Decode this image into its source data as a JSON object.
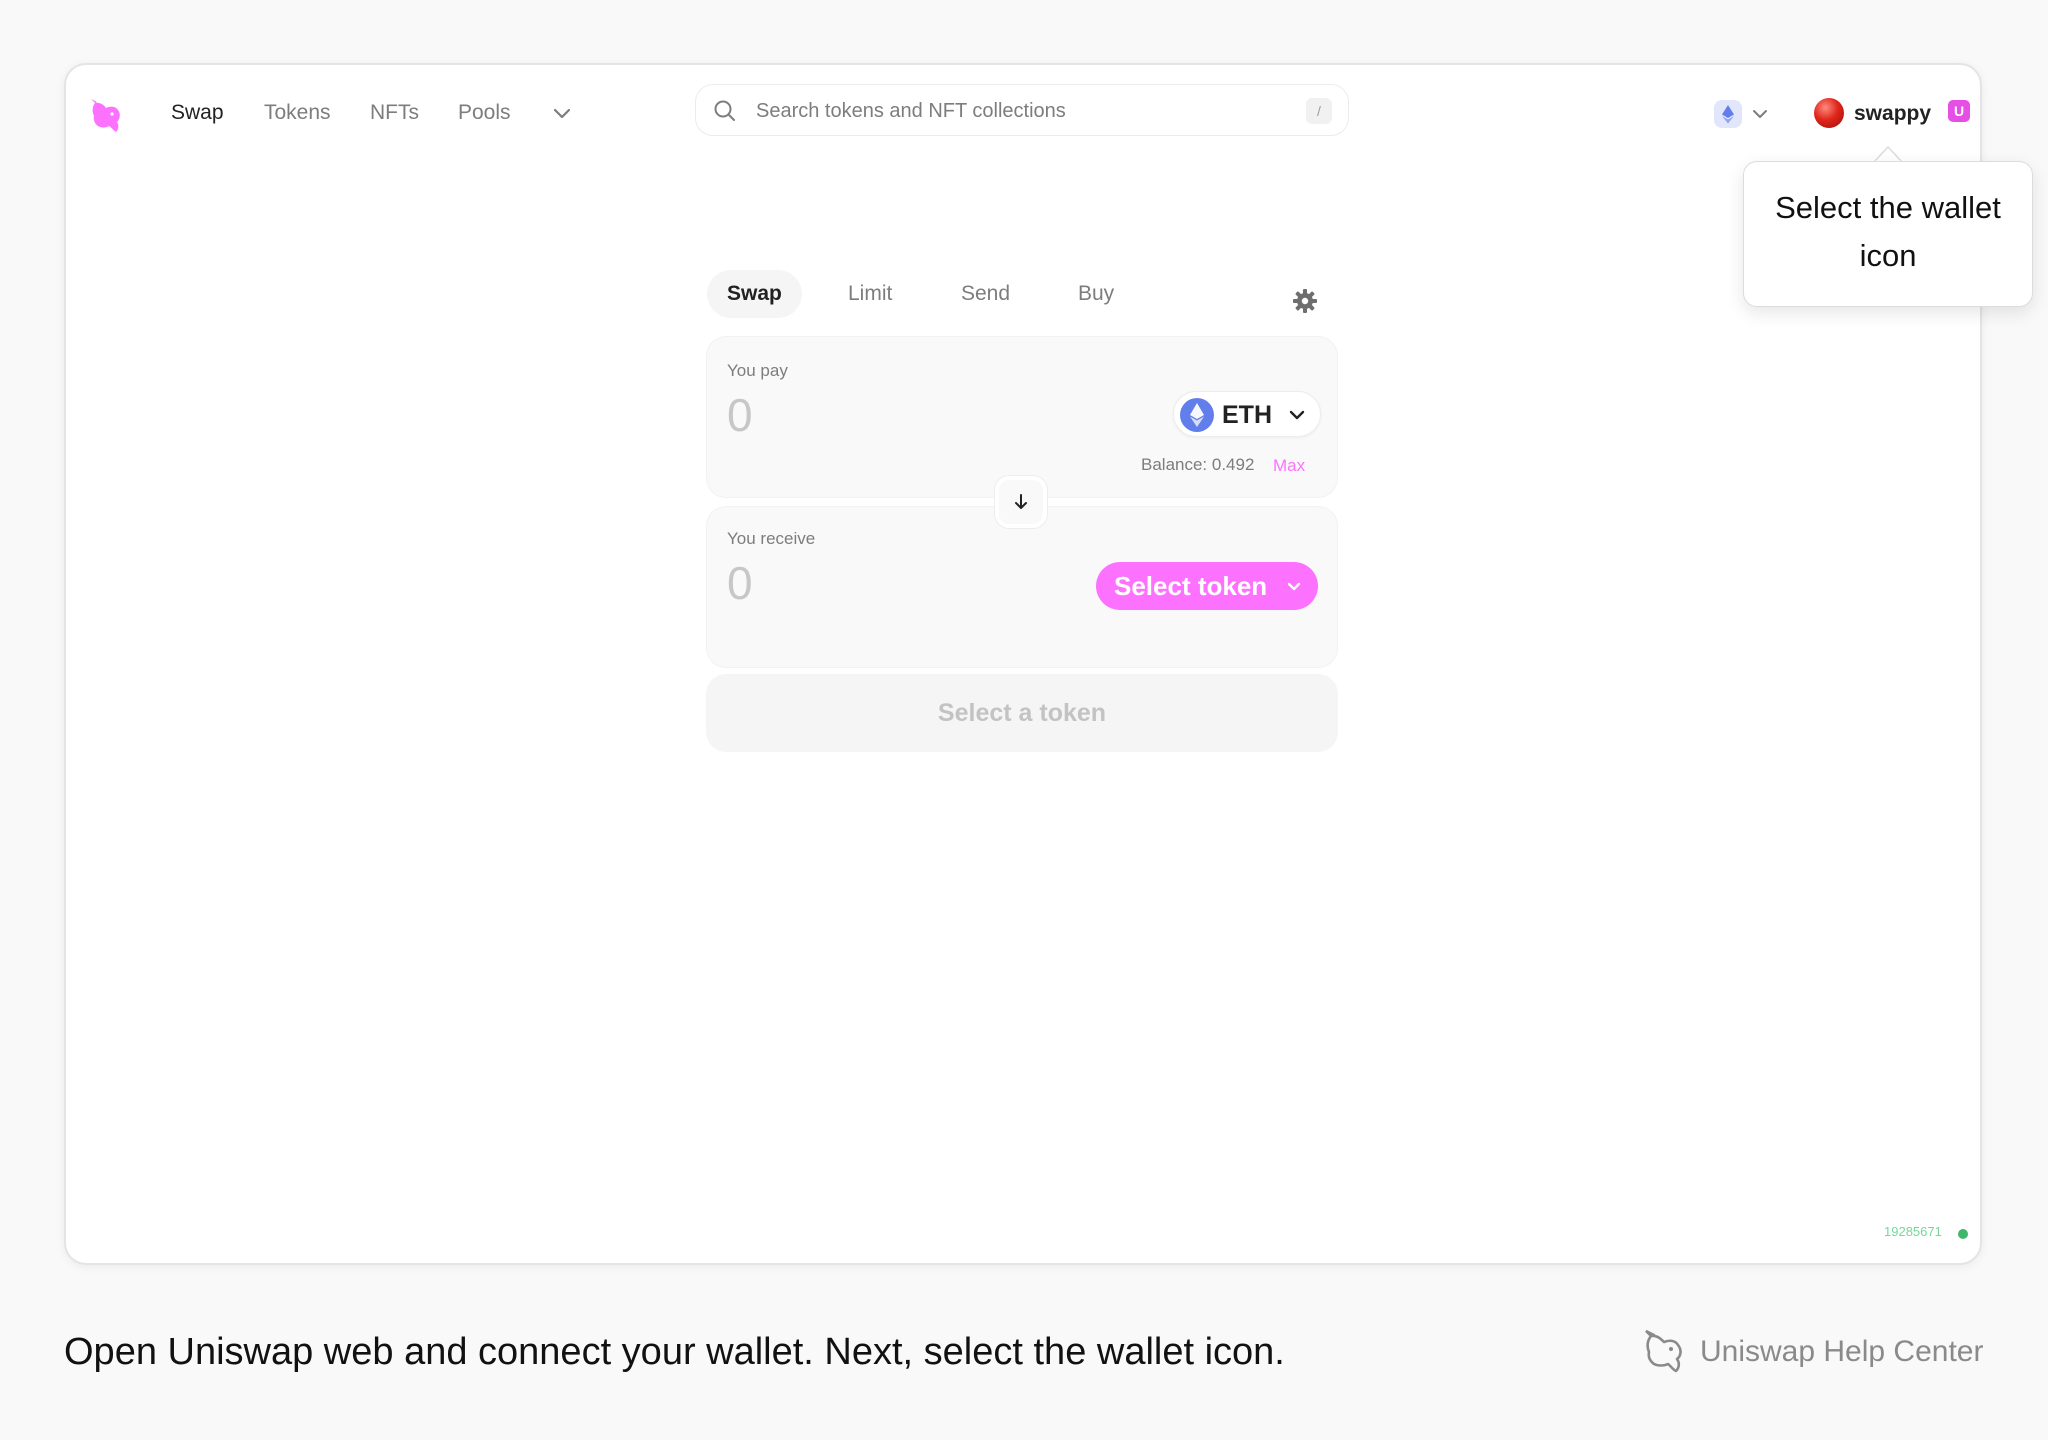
{
  "nav": {
    "logo": "uniswap-unicorn-icon",
    "links": [
      "Swap",
      "Tokens",
      "NFTs",
      "Pools"
    ],
    "more": "chevron-down-icon"
  },
  "search": {
    "placeholder": "Search tokens and NFT collections",
    "shortcut": "/"
  },
  "network": {
    "icon": "ethereum-icon"
  },
  "wallet": {
    "name": "swappy",
    "badge": "U"
  },
  "tooltip": {
    "text": "Select the wallet icon"
  },
  "swap": {
    "tabs": [
      "Swap",
      "Limit",
      "Send",
      "Buy"
    ],
    "pay": {
      "label": "You pay",
      "amount": "0",
      "token": "ETH",
      "balance": "Balance: 0.492",
      "max": "Max"
    },
    "receive": {
      "label": "You receive",
      "amount": "0",
      "select_label": "Select token"
    },
    "cta": "Select a token"
  },
  "footer": {
    "block_number": "19285671"
  },
  "caption": {
    "text": "Open Uniswap web and connect your wallet. Next, select the wallet icon.",
    "brand": "Uniswap Help Center"
  },
  "colors": {
    "accent": "#fc72ff",
    "eth": "#627eea",
    "block_status": "#40b66b"
  }
}
